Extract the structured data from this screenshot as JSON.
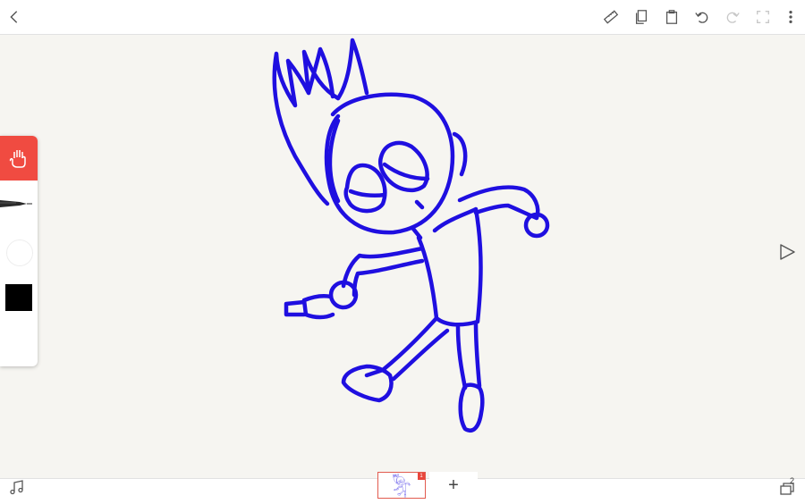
{
  "toolbar": {
    "icons": [
      "back-icon",
      "ruler-icon",
      "copy-icon",
      "paste-icon",
      "undo-icon",
      "redo-icon",
      "fullscreen-icon",
      "more-icon"
    ]
  },
  "tool_panel": {
    "active_tool": "hand-tool",
    "current_color": "#000000",
    "accent_color": "#f04b41"
  },
  "drawing": {
    "stroke_color": "#1f0fe0"
  },
  "frames": {
    "count_badge": "1",
    "add_label": "+"
  },
  "layers": {
    "count": "2"
  }
}
